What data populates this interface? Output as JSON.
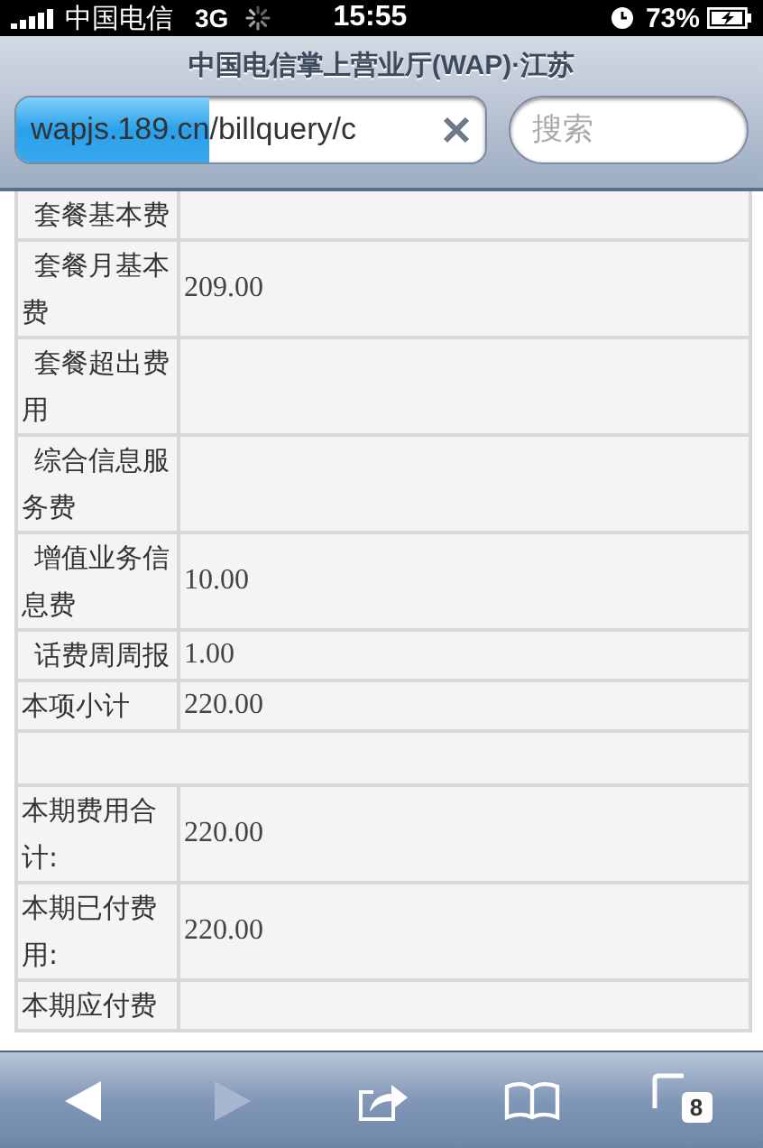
{
  "status_bar": {
    "carrier": "中国电信",
    "network": "3G",
    "time": "15:55",
    "battery": "73%"
  },
  "browser": {
    "title": "中国电信掌上营业厅(WAP)·江苏",
    "url": {
      "value": "wapjs.189.cn/billquery/c",
      "level": 0.41
    },
    "search": {
      "placeholder": "搜索"
    }
  },
  "table": {
    "rows": [
      {
        "kind": "item",
        "label": "套餐基本费"
      },
      {
        "kind": "item",
        "label": "套餐月基本费",
        "value": "209.00"
      },
      {
        "kind": "item",
        "label": "套餐超出费用"
      },
      {
        "kind": "item",
        "label": "综合信息服务费"
      },
      {
        "kind": "item",
        "label": "增值业务信息费",
        "value": "10.00"
      },
      {
        "kind": "item",
        "label": "话费周周报",
        "value": "1.00"
      },
      {
        "kind": "total",
        "label": "本项小计",
        "value": "220.00"
      },
      {
        "kind": "blank"
      },
      {
        "kind": "total",
        "label": "本期费用合计:",
        "value": "220.00"
      },
      {
        "kind": "total",
        "label": "本期已付费用:",
        "value": "220.00"
      },
      {
        "kind": "total",
        "label": "本期应付费"
      }
    ]
  },
  "toolbar": [
    {
      "kind": "back",
      "disabled": false
    },
    {
      "kind": "forward",
      "disabled": true
    },
    {
      "kind": "share",
      "disabled": false
    },
    {
      "kind": "bookmarks",
      "disabled": false
    },
    {
      "kind": "tabs",
      "disabled": false,
      "count": "8"
    }
  ]
}
